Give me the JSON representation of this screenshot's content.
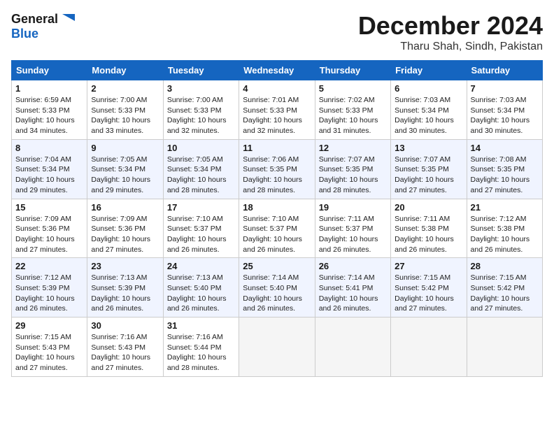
{
  "logo": {
    "line1": "General",
    "line2": "Blue"
  },
  "title": "December 2024",
  "location": "Tharu Shah, Sindh, Pakistan",
  "weekdays": [
    "Sunday",
    "Monday",
    "Tuesday",
    "Wednesday",
    "Thursday",
    "Friday",
    "Saturday"
  ],
  "weeks": [
    [
      {
        "day": "1",
        "sunrise": "6:59 AM",
        "sunset": "5:33 PM",
        "daylight": "10 hours and 34 minutes."
      },
      {
        "day": "2",
        "sunrise": "7:00 AM",
        "sunset": "5:33 PM",
        "daylight": "10 hours and 33 minutes."
      },
      {
        "day": "3",
        "sunrise": "7:00 AM",
        "sunset": "5:33 PM",
        "daylight": "10 hours and 32 minutes."
      },
      {
        "day": "4",
        "sunrise": "7:01 AM",
        "sunset": "5:33 PM",
        "daylight": "10 hours and 32 minutes."
      },
      {
        "day": "5",
        "sunrise": "7:02 AM",
        "sunset": "5:33 PM",
        "daylight": "10 hours and 31 minutes."
      },
      {
        "day": "6",
        "sunrise": "7:03 AM",
        "sunset": "5:34 PM",
        "daylight": "10 hours and 30 minutes."
      },
      {
        "day": "7",
        "sunrise": "7:03 AM",
        "sunset": "5:34 PM",
        "daylight": "10 hours and 30 minutes."
      }
    ],
    [
      {
        "day": "8",
        "sunrise": "7:04 AM",
        "sunset": "5:34 PM",
        "daylight": "10 hours and 29 minutes."
      },
      {
        "day": "9",
        "sunrise": "7:05 AM",
        "sunset": "5:34 PM",
        "daylight": "10 hours and 29 minutes."
      },
      {
        "day": "10",
        "sunrise": "7:05 AM",
        "sunset": "5:34 PM",
        "daylight": "10 hours and 28 minutes."
      },
      {
        "day": "11",
        "sunrise": "7:06 AM",
        "sunset": "5:35 PM",
        "daylight": "10 hours and 28 minutes."
      },
      {
        "day": "12",
        "sunrise": "7:07 AM",
        "sunset": "5:35 PM",
        "daylight": "10 hours and 28 minutes."
      },
      {
        "day": "13",
        "sunrise": "7:07 AM",
        "sunset": "5:35 PM",
        "daylight": "10 hours and 27 minutes."
      },
      {
        "day": "14",
        "sunrise": "7:08 AM",
        "sunset": "5:35 PM",
        "daylight": "10 hours and 27 minutes."
      }
    ],
    [
      {
        "day": "15",
        "sunrise": "7:09 AM",
        "sunset": "5:36 PM",
        "daylight": "10 hours and 27 minutes."
      },
      {
        "day": "16",
        "sunrise": "7:09 AM",
        "sunset": "5:36 PM",
        "daylight": "10 hours and 27 minutes."
      },
      {
        "day": "17",
        "sunrise": "7:10 AM",
        "sunset": "5:37 PM",
        "daylight": "10 hours and 26 minutes."
      },
      {
        "day": "18",
        "sunrise": "7:10 AM",
        "sunset": "5:37 PM",
        "daylight": "10 hours and 26 minutes."
      },
      {
        "day": "19",
        "sunrise": "7:11 AM",
        "sunset": "5:37 PM",
        "daylight": "10 hours and 26 minutes."
      },
      {
        "day": "20",
        "sunrise": "7:11 AM",
        "sunset": "5:38 PM",
        "daylight": "10 hours and 26 minutes."
      },
      {
        "day": "21",
        "sunrise": "7:12 AM",
        "sunset": "5:38 PM",
        "daylight": "10 hours and 26 minutes."
      }
    ],
    [
      {
        "day": "22",
        "sunrise": "7:12 AM",
        "sunset": "5:39 PM",
        "daylight": "10 hours and 26 minutes."
      },
      {
        "day": "23",
        "sunrise": "7:13 AM",
        "sunset": "5:39 PM",
        "daylight": "10 hours and 26 minutes."
      },
      {
        "day": "24",
        "sunrise": "7:13 AM",
        "sunset": "5:40 PM",
        "daylight": "10 hours and 26 minutes."
      },
      {
        "day": "25",
        "sunrise": "7:14 AM",
        "sunset": "5:40 PM",
        "daylight": "10 hours and 26 minutes."
      },
      {
        "day": "26",
        "sunrise": "7:14 AM",
        "sunset": "5:41 PM",
        "daylight": "10 hours and 26 minutes."
      },
      {
        "day": "27",
        "sunrise": "7:15 AM",
        "sunset": "5:42 PM",
        "daylight": "10 hours and 27 minutes."
      },
      {
        "day": "28",
        "sunrise": "7:15 AM",
        "sunset": "5:42 PM",
        "daylight": "10 hours and 27 minutes."
      }
    ],
    [
      {
        "day": "29",
        "sunrise": "7:15 AM",
        "sunset": "5:43 PM",
        "daylight": "10 hours and 27 minutes."
      },
      {
        "day": "30",
        "sunrise": "7:16 AM",
        "sunset": "5:43 PM",
        "daylight": "10 hours and 27 minutes."
      },
      {
        "day": "31",
        "sunrise": "7:16 AM",
        "sunset": "5:44 PM",
        "daylight": "10 hours and 28 minutes."
      },
      null,
      null,
      null,
      null
    ]
  ]
}
